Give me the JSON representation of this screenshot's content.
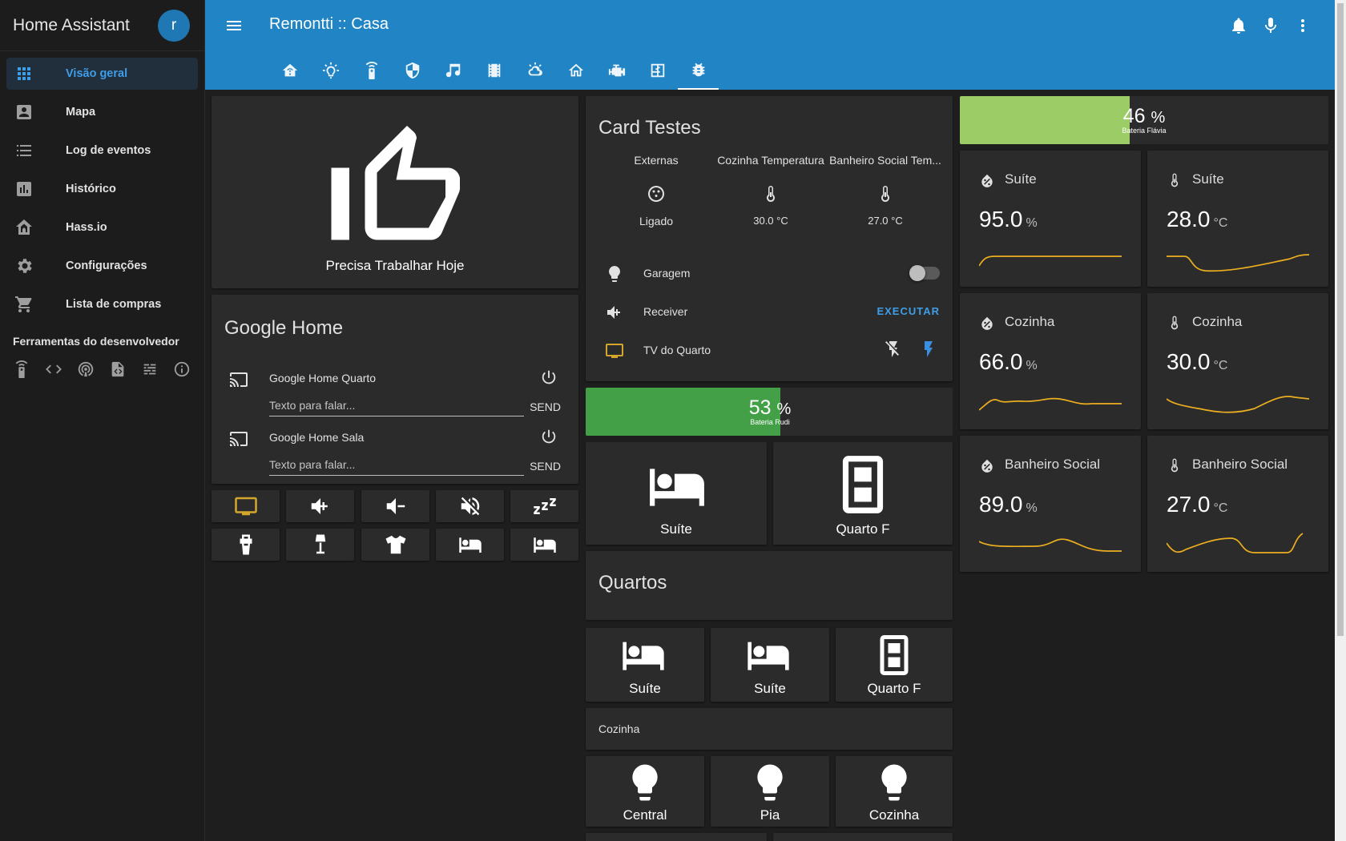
{
  "app": {
    "title": "Home Assistant",
    "user_initial": "r"
  },
  "sidebar": {
    "items": [
      {
        "label": "Visão geral",
        "icon": "grid-icon",
        "active": true
      },
      {
        "label": "Mapa",
        "icon": "account-box-icon"
      },
      {
        "label": "Log de eventos",
        "icon": "list-icon"
      },
      {
        "label": "Histórico",
        "icon": "chart-icon"
      },
      {
        "label": "Hass.io",
        "icon": "home-assistant-icon"
      },
      {
        "label": "Configurações",
        "icon": "gear-icon"
      },
      {
        "label": "Lista de compras",
        "icon": "cart-icon"
      }
    ],
    "dev_tools_title": "Ferramentas do desenvolvedor",
    "dev_tools_icons": [
      "remote-icon",
      "code-icon",
      "podcast-icon",
      "file-code-icon",
      "timeline-icon",
      "info-icon"
    ]
  },
  "topbar": {
    "title": "Remontti :: Casa",
    "tabs": [
      "home-automation-icon",
      "lightbulb-icon",
      "remote-icon",
      "shield-icon",
      "music-icon",
      "film-icon",
      "weather-icon",
      "home-icon",
      "engine-icon",
      "floor-plan-icon",
      "bug-icon"
    ],
    "active_tab": 10,
    "actions": [
      "bell-icon",
      "microphone-icon",
      "dots-vertical-icon"
    ]
  },
  "card_work": {
    "label": "Precisa Trabalhar Hoje"
  },
  "google_home": {
    "title": "Google Home",
    "devices": [
      {
        "name": "Google Home Quarto",
        "placeholder": "Texto para falar...",
        "send": "SEND"
      },
      {
        "name": "Google Home Sala",
        "placeholder": "Texto para falar...",
        "send": "SEND"
      }
    ]
  },
  "remote_buttons": [
    "tv-icon",
    "volume-plus-icon",
    "volume-minus-icon",
    "volume-off-icon",
    "sleep-icon",
    "fan-icon",
    "lamp-icon",
    "tshirt-icon",
    "bed-icon",
    "bed-icon"
  ],
  "card_testes": {
    "title": "Card Testes",
    "entities": [
      {
        "header": "Externas",
        "icon": "ceiling-light-icon",
        "state": "Ligado"
      },
      {
        "header": "Cozinha Temperatura",
        "icon": "thermometer-icon",
        "state": "30.0 °C"
      },
      {
        "header": "Banheiro Social Tem...",
        "icon": "thermometer-icon",
        "state": "27.0 °C"
      }
    ],
    "rows": [
      {
        "label": "Garagem",
        "icon": "lightbulb-icon",
        "control": "toggle",
        "on": false
      },
      {
        "label": "Receiver",
        "icon": "volume-plus-icon",
        "control": "button",
        "action": "EXECUTAR"
      },
      {
        "label": "TV do Quarto",
        "icon": "tv-icon",
        "control": "flash"
      }
    ]
  },
  "battery_rudi": {
    "value": "53",
    "unit": "%",
    "label": "Bateria Rudi",
    "fraction": 0.53,
    "color": "#43a047"
  },
  "battery_flavia": {
    "value": "46",
    "unit": "%",
    "label": "Bateria Flávia",
    "fraction": 0.46,
    "color": "#9ccc65"
  },
  "tiles_top": [
    {
      "label": "Suíte",
      "icon": "bed-icon"
    },
    {
      "label": "Quarto F",
      "icon": "door-icon"
    }
  ],
  "quartos": {
    "title": "Quartos"
  },
  "tiles_quartos": [
    {
      "label": "Suíte",
      "icon": "bed-icon"
    },
    {
      "label": "Suíte",
      "icon": "bed-icon"
    },
    {
      "label": "Quarto F",
      "icon": "door-icon"
    }
  ],
  "cozinha": {
    "title": "Cozinha"
  },
  "tiles_cozinha": [
    {
      "label": "Central",
      "icon": "lightbulb-icon"
    },
    {
      "label": "Pia",
      "icon": "lightbulb-icon"
    },
    {
      "label": "Cozinha",
      "icon": "lightbulb-icon"
    }
  ],
  "sensors": [
    {
      "name": "Suíte",
      "value": "95.0",
      "unit": "%",
      "icon": "water-percent-icon"
    },
    {
      "name": "Suíte",
      "value": "28.0",
      "unit": "°C",
      "icon": "thermometer-icon"
    },
    {
      "name": "Cozinha",
      "value": "66.0",
      "unit": "%",
      "icon": "water-percent-icon"
    },
    {
      "name": "Cozinha",
      "value": "30.0",
      "unit": "°C",
      "icon": "thermometer-icon"
    },
    {
      "name": "Banheiro Social",
      "value": "89.0",
      "unit": "%",
      "icon": "water-percent-icon"
    },
    {
      "name": "Banheiro Social",
      "value": "27.0",
      "unit": "°C",
      "icon": "thermometer-icon"
    }
  ],
  "colors": {
    "header": "#2184c4",
    "accent": "#3e9ee8",
    "spark": "#ecae21",
    "tv_icon": "#d4a72c",
    "flash_on": "#3b8fe0"
  }
}
